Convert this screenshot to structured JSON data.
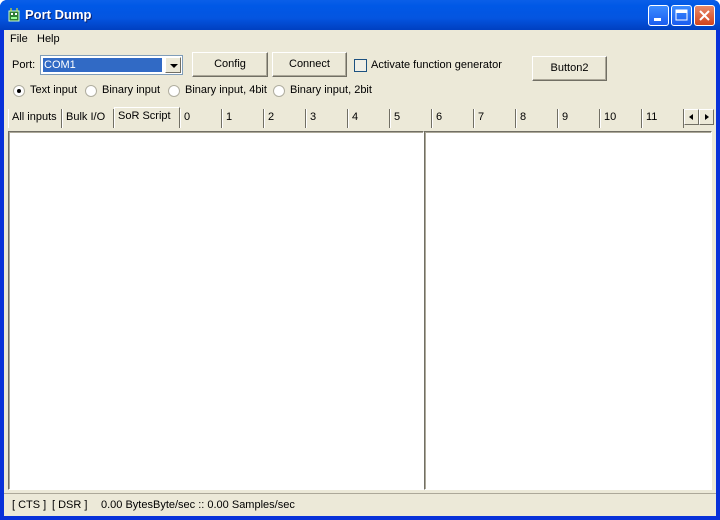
{
  "window": {
    "title": "Port Dump",
    "icon": "app-icon",
    "controls": [
      "minimize",
      "maximize",
      "close"
    ]
  },
  "menu": [
    "File",
    "Help"
  ],
  "toolbar": {
    "port_label": "Port:",
    "port_value": "COM1",
    "config_label": "Config",
    "connect_label": "Connect",
    "function_generator_label": "Activate function generator",
    "function_generator_checked": false,
    "button2_label": "Button2"
  },
  "input_modes": [
    {
      "label": "Text input",
      "selected": true
    },
    {
      "label": "Binary input",
      "selected": false
    },
    {
      "label": "Binary input, 4bit",
      "selected": false
    },
    {
      "label": "Binary input, 2bit",
      "selected": false
    }
  ],
  "tabs": [
    "All inputs",
    "Bulk I/O",
    "SoR Script",
    "0",
    "1",
    "2",
    "3",
    "4",
    "5",
    "6",
    "7",
    "8",
    "9",
    "10",
    "11"
  ],
  "active_tab": "SoR Script",
  "status": {
    "cts": "[ CTS ]",
    "dsr": "[ DSR ]",
    "rate": "0.00 BytesByte/sec :: 0.00 Samples/sec"
  }
}
